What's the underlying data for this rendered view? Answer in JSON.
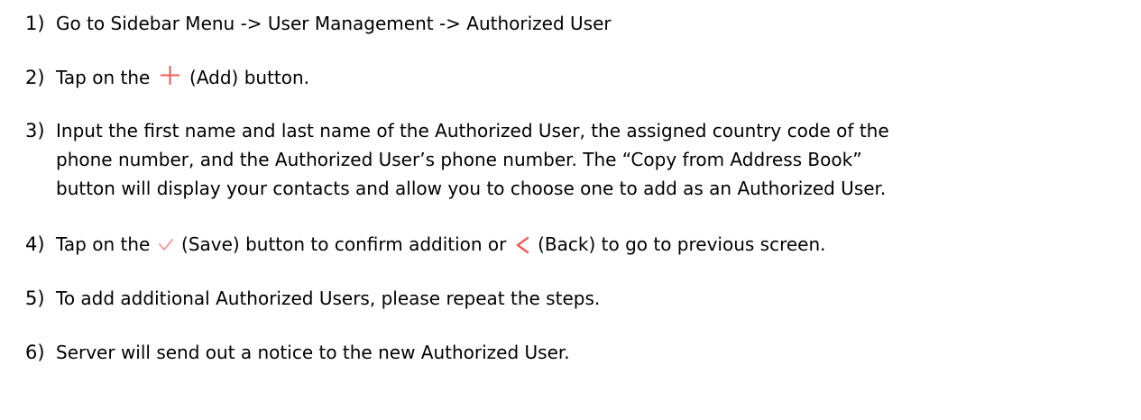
{
  "colors": {
    "text": "#000000",
    "icon_accent": "#f25a5a",
    "check_accent": "#f0a0a0"
  },
  "steps": [
    {
      "number": "1)",
      "text": "Go to Sidebar Menu -> User Management -> Authorized User"
    },
    {
      "number": "2)",
      "before": "Tap on the",
      "icon": "plus-icon",
      "after": "(Add) button."
    },
    {
      "number": "3)",
      "lines": [
        "Input the first name and last name of the Authorized User, the assigned country code of the",
        "phone number, and the Authorized User’s phone number. The “Copy from Address Book”",
        "button will display your contacts and allow you to choose one to add as an Authorized User."
      ]
    },
    {
      "number": "4)",
      "before": "Tap on the",
      "icon": "check-icon",
      "middle": "(Save) button to confirm addition or",
      "icon2": "back-icon",
      "after": "(Back) to go to previous screen."
    },
    {
      "number": "5)",
      "text": "To add additional Authorized Users, please repeat the steps."
    },
    {
      "number": "6)",
      "text": "Server will send out a notice to the new Authorized User."
    }
  ]
}
